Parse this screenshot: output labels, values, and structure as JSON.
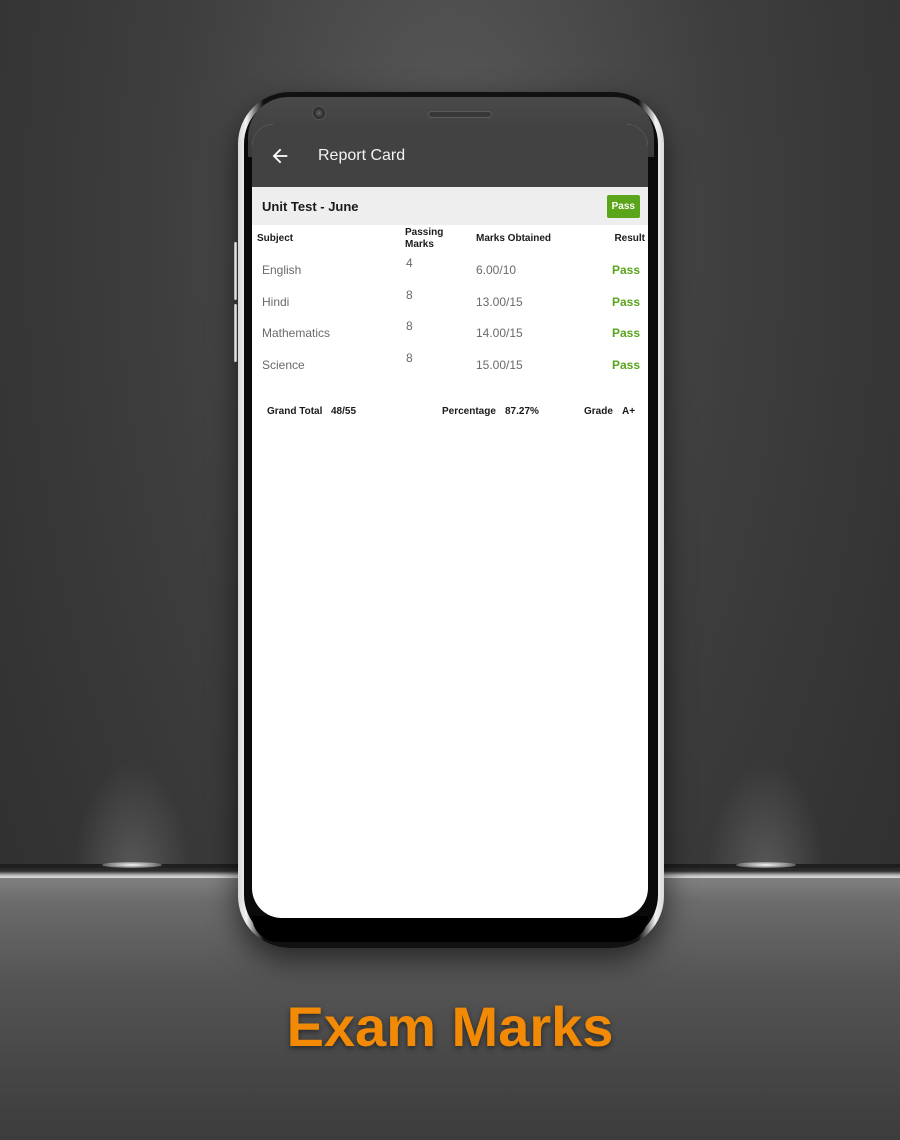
{
  "app": {
    "title": "Report Card",
    "back_icon": "arrow-left-icon"
  },
  "exam": {
    "title": "Unit Test - June",
    "overall_result": "Pass"
  },
  "table": {
    "headers": {
      "subject": "Subject",
      "passing_marks": "Passing Marks",
      "marks_obtained": "Marks Obtained",
      "result": "Result"
    },
    "rows": [
      {
        "subject": "English",
        "passing_marks": "4",
        "marks_obtained": "6.00/10",
        "result": "Pass"
      },
      {
        "subject": "Hindi",
        "passing_marks": "8",
        "marks_obtained": "13.00/15",
        "result": "Pass"
      },
      {
        "subject": "Mathematics",
        "passing_marks": "8",
        "marks_obtained": "14.00/15",
        "result": "Pass"
      },
      {
        "subject": "Science",
        "passing_marks": "8",
        "marks_obtained": "15.00/15",
        "result": "Pass"
      }
    ]
  },
  "summary": {
    "grand_total_label": "Grand Total",
    "grand_total_value": "48/55",
    "percentage_label": "Percentage",
    "percentage_value": "87.27%",
    "grade_label": "Grade",
    "grade_value": "A+"
  },
  "caption": "Exam Marks",
  "colors": {
    "appbar": "#424242",
    "pass_green": "#5aa51a",
    "caption_orange": "#f28a06"
  }
}
